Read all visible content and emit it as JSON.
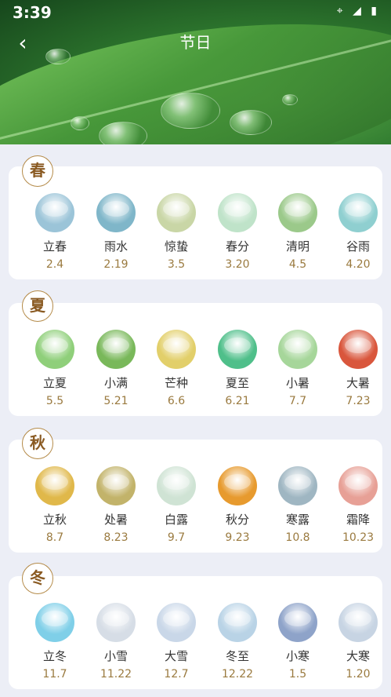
{
  "status_bar": {
    "time": "3:39",
    "icons": "⌖ ◢ ▮"
  },
  "header": {
    "title": "节日",
    "back_icon": "back-arrow-icon"
  },
  "seasons": [
    {
      "badge": "春",
      "items": [
        {
          "name": "立春",
          "date": "2.4",
          "color": "#9bc4d8"
        },
        {
          "name": "雨水",
          "date": "2.19",
          "color": "#7fb6c9"
        },
        {
          "name": "惊蛰",
          "date": "3.5",
          "color": "#c9d6a6"
        },
        {
          "name": "春分",
          "date": "3.20",
          "color": "#bfe3c9"
        },
        {
          "name": "清明",
          "date": "4.5",
          "color": "#9bc98a"
        },
        {
          "name": "谷雨",
          "date": "4.20",
          "color": "#8fcfd0"
        }
      ]
    },
    {
      "badge": "夏",
      "items": [
        {
          "name": "立夏",
          "date": "5.5",
          "color": "#8fcf7a"
        },
        {
          "name": "小满",
          "date": "5.21",
          "color": "#79b85a"
        },
        {
          "name": "芒种",
          "date": "6.6",
          "color": "#e2cf6a"
        },
        {
          "name": "夏至",
          "date": "6.21",
          "color": "#4fbf8a"
        },
        {
          "name": "小暑",
          "date": "7.7",
          "color": "#a6d69a"
        },
        {
          "name": "大暑",
          "date": "7.23",
          "color": "#d9563c"
        }
      ]
    },
    {
      "badge": "秋",
      "items": [
        {
          "name": "立秋",
          "date": "8.7",
          "color": "#e0b84a"
        },
        {
          "name": "处暑",
          "date": "8.23",
          "color": "#c2b36a"
        },
        {
          "name": "白露",
          "date": "9.7",
          "color": "#cfe3d4"
        },
        {
          "name": "秋分",
          "date": "9.23",
          "color": "#e79a2e"
        },
        {
          "name": "寒露",
          "date": "10.8",
          "color": "#9fb6c2"
        },
        {
          "name": "霜降",
          "date": "10.23",
          "color": "#e7a096"
        }
      ]
    },
    {
      "badge": "冬",
      "items": [
        {
          "name": "立冬",
          "date": "11.7",
          "color": "#7fcfe8"
        },
        {
          "name": "小雪",
          "date": "11.22",
          "color": "#d6dde6"
        },
        {
          "name": "大雪",
          "date": "12.7",
          "color": "#c9d7e8"
        },
        {
          "name": "冬至",
          "date": "12.22",
          "color": "#b9d3e6"
        },
        {
          "name": "小寒",
          "date": "1.5",
          "color": "#8ea3c9"
        },
        {
          "name": "大寒",
          "date": "1.20",
          "color": "#c7d4e3"
        }
      ]
    }
  ]
}
